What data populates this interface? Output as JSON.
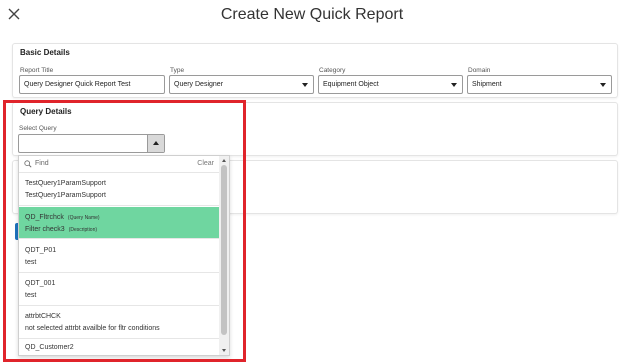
{
  "page": {
    "title": "Create New Quick Report"
  },
  "basic_details": {
    "title": "Basic Details",
    "report_title": {
      "label": "Report Title",
      "value": "Query Designer Quick Report Test"
    },
    "type": {
      "label": "Type",
      "value": "Query Designer"
    },
    "category": {
      "label": "Category",
      "value": "Equipment Object"
    },
    "domain": {
      "label": "Domain",
      "value": "Shipment"
    }
  },
  "query_details": {
    "title": "Query Details",
    "select_query": {
      "label": "Select Query",
      "value": "",
      "find_placeholder": "Find",
      "clear_label": "Clear",
      "options": [
        {
          "name": "TestQuery1ParamSupport",
          "description": "TestQuery1ParamSupport",
          "selected": false
        },
        {
          "name": "QD_Fltrchck",
          "name_tag": "(Query Name)",
          "description": "Filter check3",
          "description_tag": "(Description)",
          "selected": true
        },
        {
          "name": "QDT_P01",
          "description": "test",
          "selected": false
        },
        {
          "name": "QDT_001",
          "description": "test",
          "selected": false
        },
        {
          "name": "attrbtCHCK",
          "description": "not selected attrbt availble for fltr conditions",
          "selected": false
        },
        {
          "name": "QD_Customer2",
          "description": "",
          "selected": false
        }
      ]
    }
  },
  "colors": {
    "highlight": "#e0242b",
    "selected_option": "#6fd6a0",
    "accent": "#1e73be"
  },
  "icons": {
    "close": "close-icon",
    "search": "search-icon"
  }
}
